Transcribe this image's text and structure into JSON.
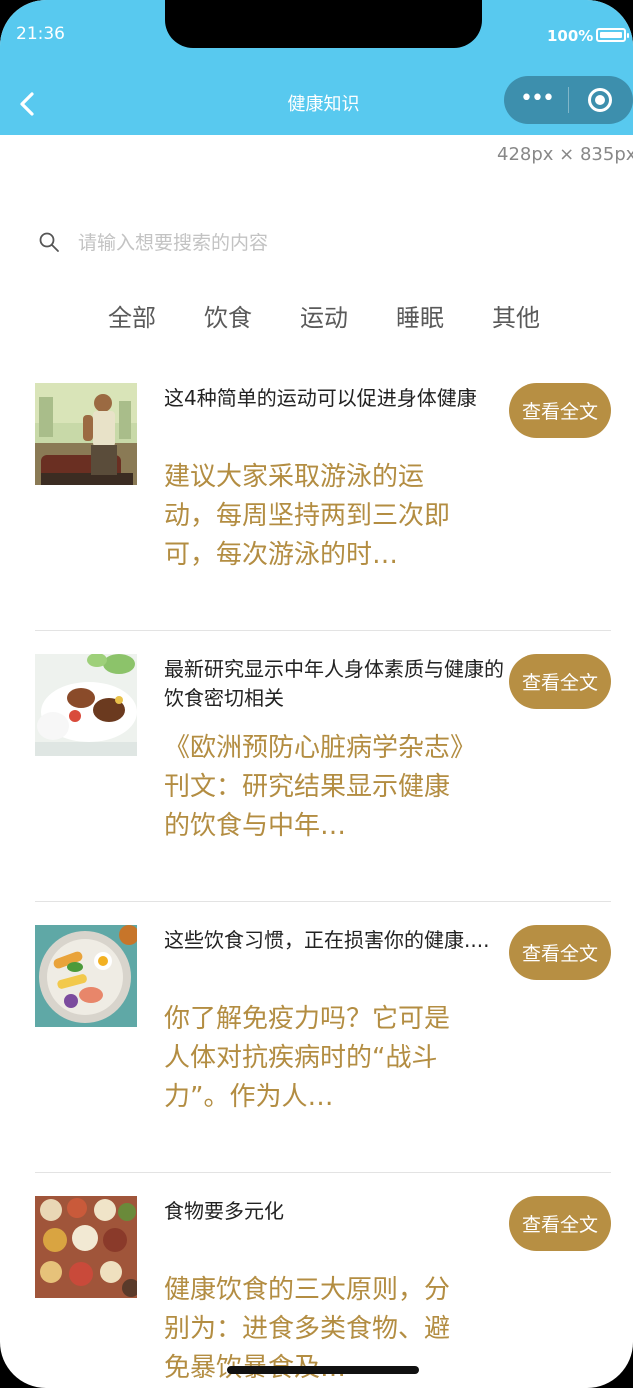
{
  "status_bar": {
    "time": "21:36",
    "battery": "100%"
  },
  "nav": {
    "title": "健康知识",
    "capsule_dots": "•••"
  },
  "dimension_label": "428px × 835px",
  "search": {
    "placeholder": "请输入想要搜索的内容"
  },
  "tabs": [
    {
      "label": "全部"
    },
    {
      "label": "饮食"
    },
    {
      "label": "运动"
    },
    {
      "label": "睡眠"
    },
    {
      "label": "其他"
    }
  ],
  "articles": [
    {
      "title": "这4种简单的运动可以促进身体健康",
      "summary": "建议大家采取游泳的运动，每周坚持两到三次即可，每次游泳的时…",
      "button": "查看全文",
      "thumb_icon": "man-by-car-photo"
    },
    {
      "title": "最新研究显示中年人身体素质与健康的饮食密切相关",
      "summary": "《欧洲预防心脏病学杂志》刊文：研究结果显示健康的饮食与中年…",
      "button": "查看全文",
      "thumb_icon": "meal-plate-photo"
    },
    {
      "title": "这些饮食习惯，正在损害你的健康....",
      "summary": "你了解免疫力吗？它可是人体对抗疾病时的“战斗力”。作为人…",
      "button": "查看全文",
      "thumb_icon": "salad-bowl-photo"
    },
    {
      "title": "食物要多元化",
      "summary": "健康饮食的三大原则，分别为：进食多类食物、避免暴饮暴食及…",
      "button": "查看全文",
      "thumb_icon": "many-dishes-photo"
    }
  ],
  "colors": {
    "header_bg": "#58c9ef",
    "capsule_bg": "#3d8fad",
    "accent_gold": "#b78f43",
    "summary_text": "#b38d42"
  }
}
